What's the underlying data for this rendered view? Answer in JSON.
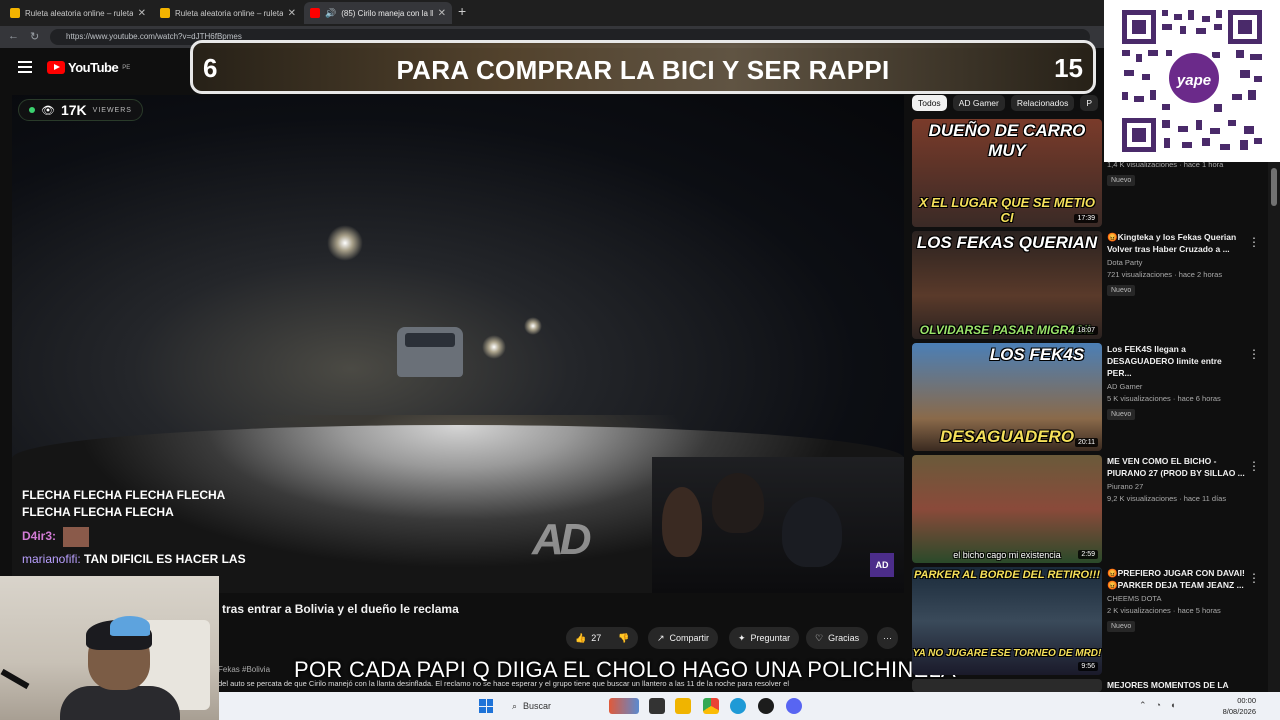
{
  "browser": {
    "tabs": [
      {
        "title": "Ruleta aleatoria online – ruleta de",
        "active": false,
        "favicon_color": "#f4b400"
      },
      {
        "title": "Ruleta aleatoria online – ruleta de",
        "active": false,
        "favicon_color": "#f4b400"
      },
      {
        "title": "(85) Cirilo maneja con la llant",
        "active": true,
        "favicon_color": "#ff0000"
      }
    ],
    "new_tab": "+",
    "url": "https://www.youtube.com/watch?v=dJTH6fBpmes"
  },
  "youtube": {
    "brand": "YouTube",
    "country": "PE"
  },
  "banner": {
    "left_number": "6",
    "text": "PARA COMPRAR LA BICI Y SER RAPPI",
    "right_number": "15"
  },
  "video": {
    "viewers_count": "17K",
    "viewers_label": "VIEWERS",
    "chat_lines": [
      "FLECHA FLECHA FLECHA FLECHA",
      "FLECHA FLECHA FLECHA"
    ],
    "chat_user_1": "D4ir3:",
    "chat_user_2": "marianofifi:",
    "chat_msg_2": "TAN DIFICIL ES HACER LAS",
    "watermark": "AD",
    "badge": "AD"
  },
  "video_title_visible": "tras entrar a Bolivia y el dueño le reclama",
  "actions": {
    "like_count": "27",
    "share": "Compartir",
    "ask": "Preguntar",
    "thanks": "Gracias",
    "more": "···"
  },
  "description": {
    "hashtags": "Fekas #Bolivia",
    "text": "del auto se percata de que Cirilo manejó con la llanta desinflada. El reclamo no se hace esperar y el grupo tiene que buscar un llantero a las 11 de la noche para resolver el"
  },
  "subtitle": "POR CADA PAPI Q DIIGA EL CHOLO HAGO UNA POLICHINELA",
  "sidebar": {
    "chips": [
      "Todos",
      "AD Gamer",
      "Relacionados",
      "P"
    ],
    "items": [
      {
        "thumb_line1": "DUEÑO DE CARRO MUY",
        "thumb_line2": "X EL LUGAR QUE SE METIO CI",
        "duration": "17:39",
        "title": "",
        "channel": "",
        "stats": "1,4 K visualizaciones · hace 1 hora",
        "badge": "Nuevo",
        "thumb_color": "#6d3a2c"
      },
      {
        "thumb_line1": "LOS FEKAS QUERIAN",
        "thumb_line2": "OLVIDARSE PASAR MIGR4CIL",
        "duration": "18:07",
        "title": "😡Kingteka y los Fekas Querian Volver tras Haber Cruzado a ...",
        "channel": "Dota Party",
        "stats": "721 visualizaciones · hace 2 horas",
        "badge": "Nuevo",
        "thumb_color": "#3b2a26"
      },
      {
        "thumb_line1": "LOS FEK4S",
        "thumb_line2": "DESAGUADERO",
        "duration": "20:11",
        "title": "Los FEK4S llegan a DESAGUADERO limite entre PER...",
        "channel": "AD Gamer",
        "stats": "5 K visualizaciones · hace 6 horas",
        "badge": "Nuevo",
        "thumb_color": "#2f5d8f"
      },
      {
        "thumb_line1": "",
        "thumb_line2": "el bicho cago mi existencia",
        "duration": "2:59",
        "title": "ME VEN COMO EL BICHO - PIURANO 27 (PROD BY SILLAO ...",
        "channel": "Piurano 27",
        "stats": "9,2 K visualizaciones · hace 11 días",
        "badge": "",
        "thumb_color": "#4a3a2a"
      },
      {
        "thumb_line1": "PARKER AL BORDE DEL RETIRO!!!",
        "thumb_line2": "YA NO JUGARE ESE TORNEO DE MRD!",
        "duration": "9:56",
        "title": "😡PREFIERO JUGAR CON DAVAI! 😡PARKER DEJA TEAM JEANZ ...",
        "channel": "CHEEMS DOTA",
        "stats": "2 K visualizaciones · hace 5 horas",
        "badge": "Nuevo",
        "thumb_color": "#1f2a3a"
      },
      {
        "thumb_line1": "",
        "thumb_line2": "",
        "duration": "",
        "title": "MEJORES MOMENTOS DE LA",
        "channel": "",
        "stats": "",
        "badge": "",
        "thumb_color": "#2a2a2a"
      }
    ]
  },
  "qr": {
    "brand": "yape"
  },
  "taskbar": {
    "search": "Buscar",
    "time": "00:00",
    "date": "8/08/2026"
  }
}
